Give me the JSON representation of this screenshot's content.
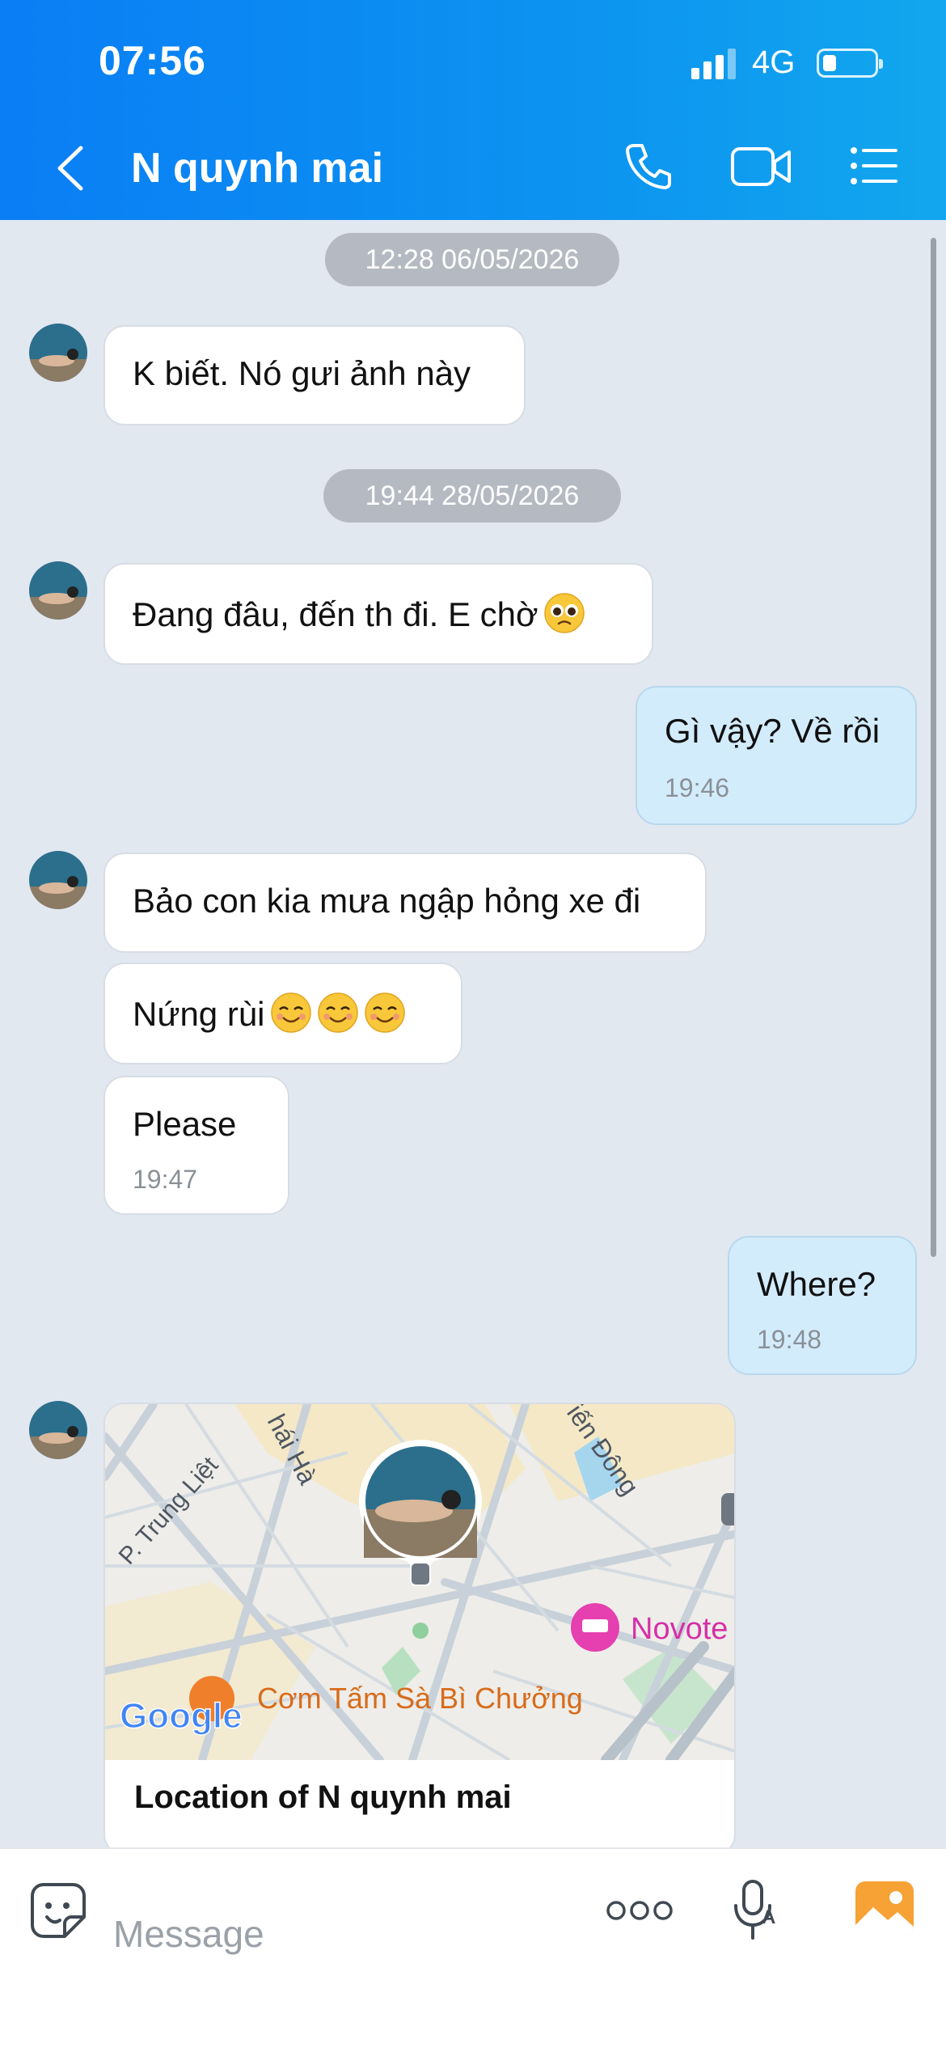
{
  "status_bar": {
    "time": "07:56",
    "network": "4G"
  },
  "header": {
    "title": "N quynh mai"
  },
  "messages": [
    {
      "date": "12:28 06/05/2026"
    },
    {
      "text": "K biết. Nó gưi ảnh này"
    },
    {
      "date": "19:44 28/05/2026"
    },
    {
      "text": "Đang đâu, đến th đi. E chờ"
    },
    {
      "text": "Gì vậy? Về rồi",
      "time": "19:46"
    },
    {
      "text": "Bảo con kia mưa ngập hỏng xe đi"
    },
    {
      "text": "Nứng rùi"
    },
    {
      "text": "Please",
      "time": "19:47"
    },
    {
      "text": "Where?",
      "time": "19:48"
    }
  ],
  "location_card": {
    "title": "Location of N quynh mai",
    "map_labels": {
      "street1": "P. Trung Liệt",
      "street2": "hái Hà",
      "street3": "iến Đông",
      "hotel": "Novote",
      "restaurant": "Cơm Tấm Sà Bì Chưởng",
      "logo": "Google"
    }
  },
  "input": {
    "placeholder": "Message"
  },
  "colors": {
    "header_start": "#0a7ef5",
    "header_end": "#12a7ee",
    "my_bubble": "#d3ecfc",
    "chat_bg": "#e2e8f0"
  }
}
